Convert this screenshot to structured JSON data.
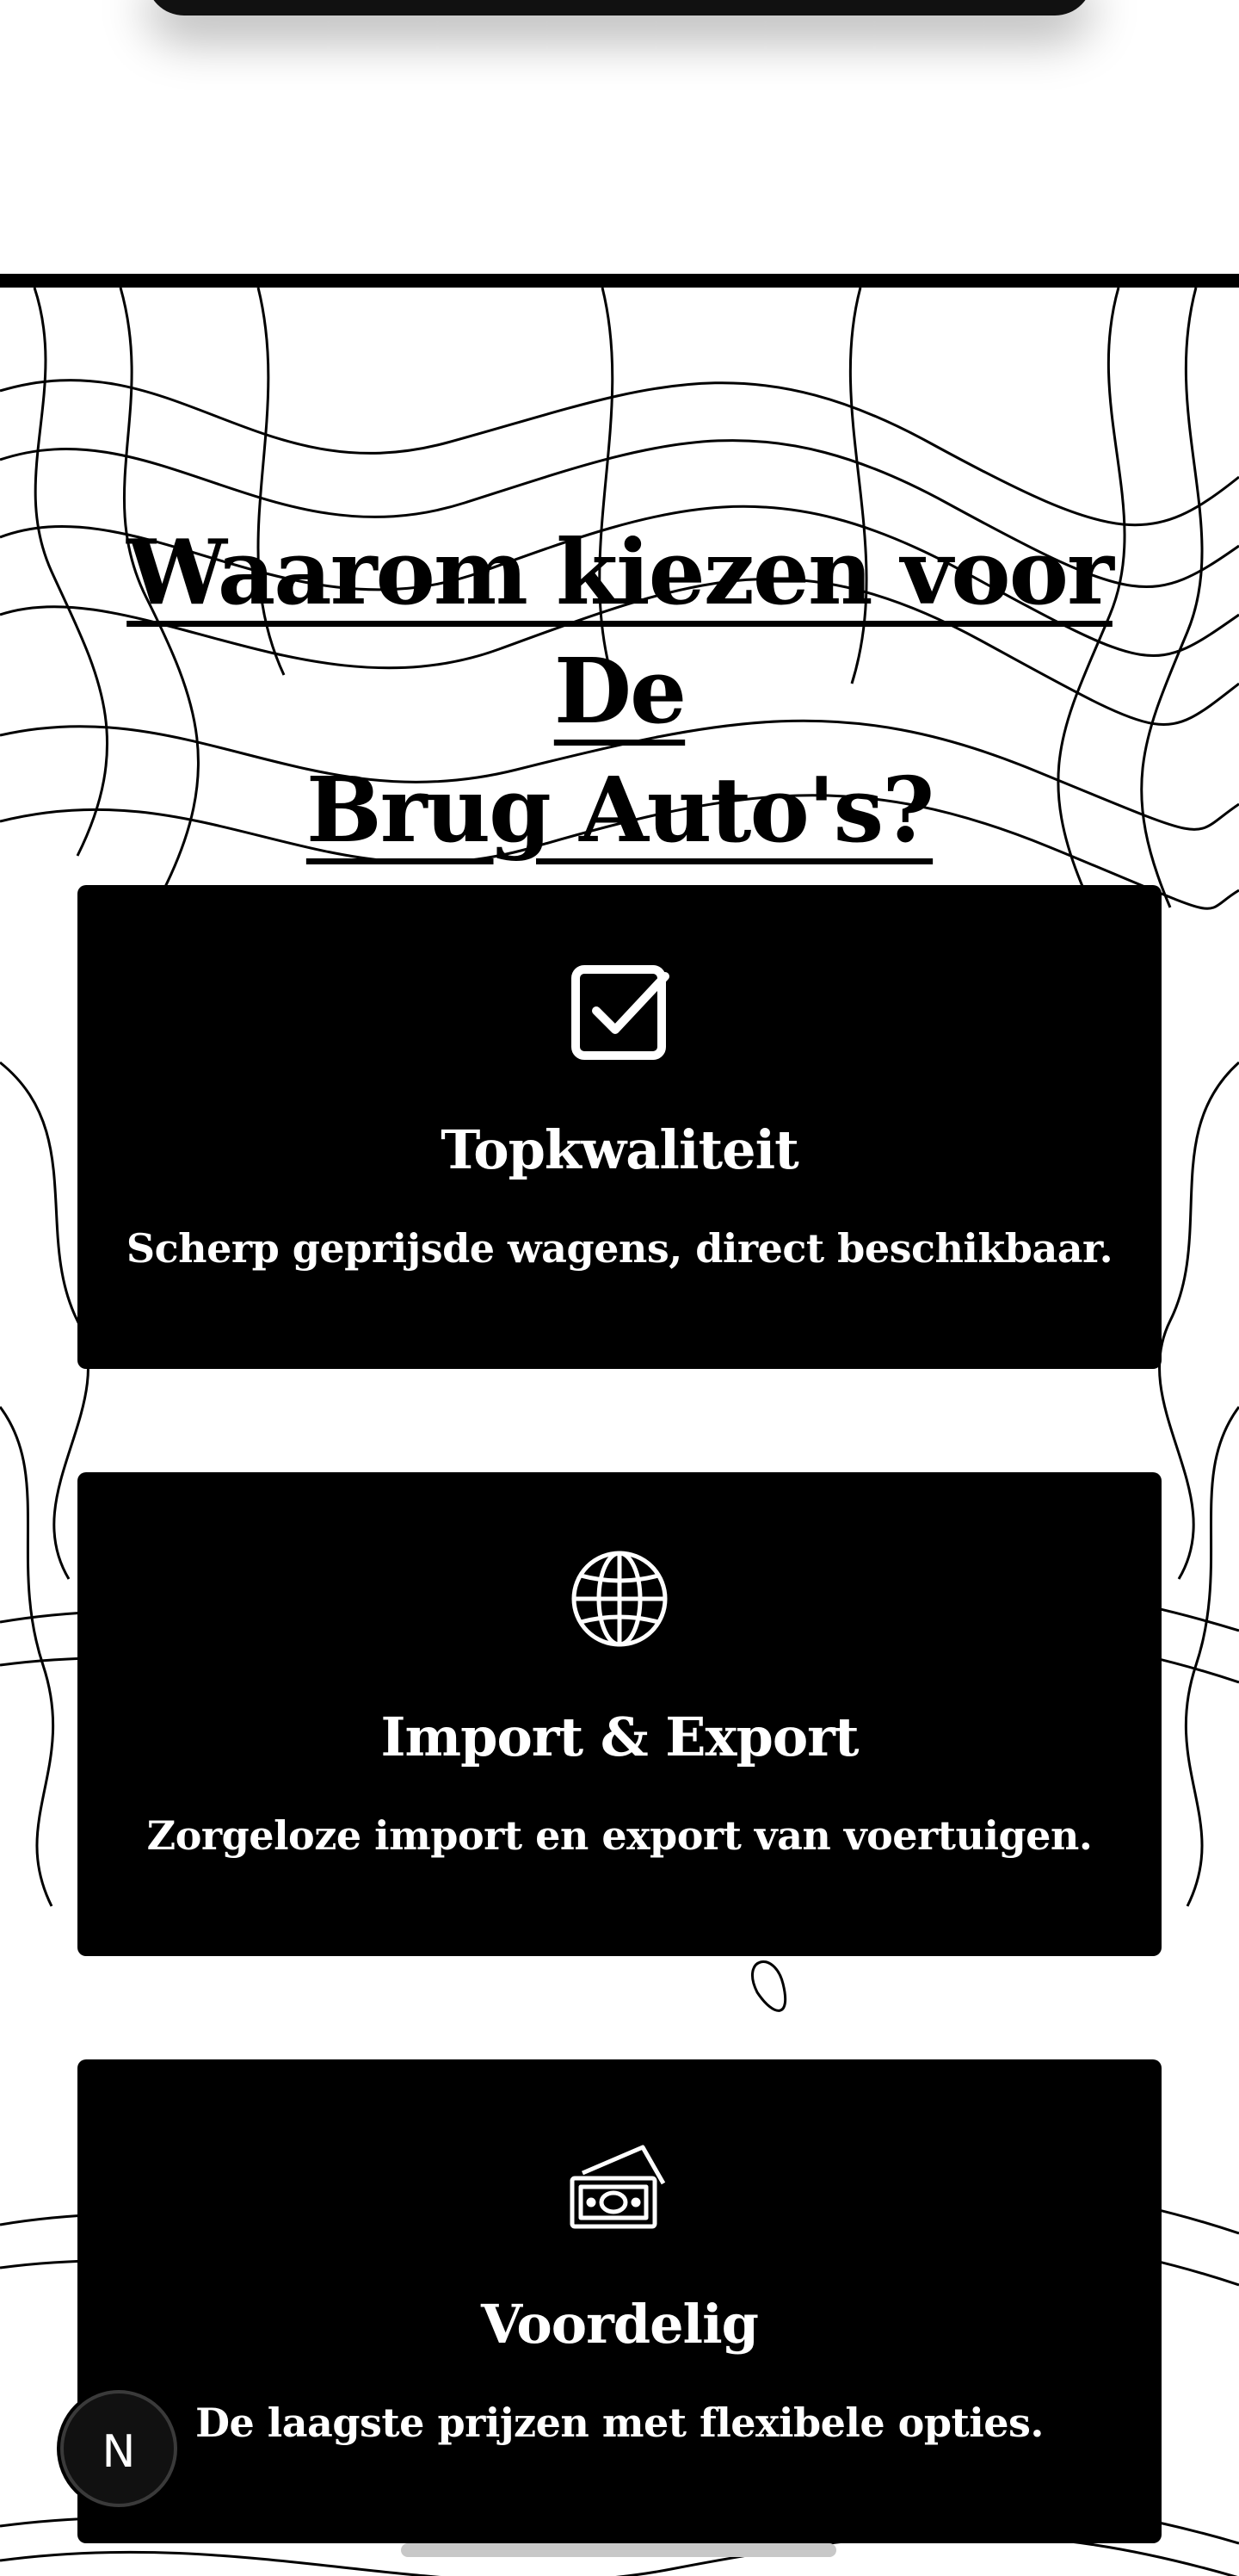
{
  "section": {
    "heading_line1": "Waarom kiezen voor De",
    "heading_line2": "Brug Auto's?"
  },
  "features": [
    {
      "icon": "checkbox-check-icon",
      "title": "Topkwaliteit",
      "description": "Scherp geprijsde wagens, direct beschikbaar."
    },
    {
      "icon": "globe-icon",
      "title": "Import & Export",
      "description": "Zorgeloze import en export van voertuigen."
    },
    {
      "icon": "money-icon",
      "title": "Voordelig",
      "description": "De laagste prijzen met flexibele opties."
    }
  ],
  "fab": {
    "label": "N"
  },
  "colors": {
    "background": "#ffffff",
    "card": "#000000",
    "text_on_card": "#ffffff",
    "heading": "#000000"
  }
}
